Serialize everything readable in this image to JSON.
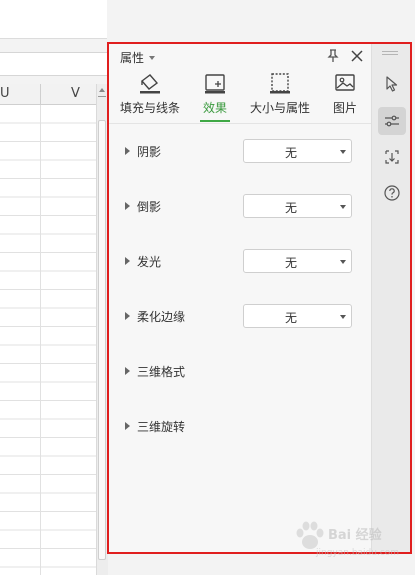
{
  "spreadsheet": {
    "columns": [
      "U",
      "V"
    ]
  },
  "panel": {
    "title": "属性",
    "tabs": [
      {
        "label": "填充与线条",
        "icon": "fill-bucket-icon",
        "active": false
      },
      {
        "label": "效果",
        "icon": "effects-icon",
        "active": true
      },
      {
        "label": "大小与属性",
        "icon": "size-properties-icon",
        "active": false
      },
      {
        "label": "图片",
        "icon": "picture-icon",
        "active": false
      }
    ],
    "properties": [
      {
        "label": "阴影",
        "value": "无"
      },
      {
        "label": "倒影",
        "value": "无"
      },
      {
        "label": "发光",
        "value": "无"
      },
      {
        "label": "柔化边缘",
        "value": "无"
      },
      {
        "label": "三维格式"
      },
      {
        "label": "三维旋转"
      }
    ]
  },
  "right_toolbar": [
    {
      "icon": "select-cursor-icon",
      "active": false
    },
    {
      "icon": "property-sliders-icon",
      "active": true
    },
    {
      "icon": "transform-icon",
      "active": false
    },
    {
      "icon": "help-icon",
      "active": false
    }
  ],
  "watermark": {
    "text": "Bai 经验",
    "sub": "jingyan.baidu.com"
  },
  "colors": {
    "accent": "#3fa845",
    "highlight_border": "#e01e1e"
  }
}
